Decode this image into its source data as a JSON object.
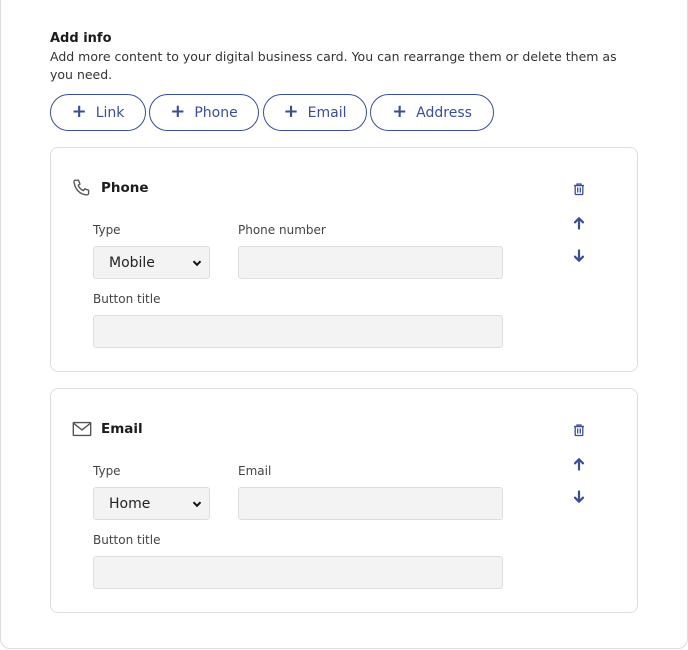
{
  "add_info": {
    "title": "Add info",
    "description": "Add more content to your digital business card. You can rearrange them or delete them as you need.",
    "buttons": [
      {
        "label": "Link",
        "icon": "plus-icon"
      },
      {
        "label": "Phone",
        "icon": "plus-icon"
      },
      {
        "label": "Email",
        "icon": "plus-icon"
      },
      {
        "label": "Address",
        "icon": "plus-icon"
      }
    ]
  },
  "cards": [
    {
      "title": "Phone",
      "icon": "phone-icon",
      "type_label": "Type",
      "type_value": "Mobile",
      "value_label": "Phone number",
      "value": "",
      "button_title_label": "Button title",
      "button_title_value": ""
    },
    {
      "title": "Email",
      "icon": "envelope-icon",
      "type_label": "Type",
      "type_value": "Home",
      "value_label": "Email",
      "value": "",
      "button_title_label": "Button title",
      "button_title_value": ""
    }
  ],
  "colors": {
    "accent": "#3a4d9b",
    "input_bg": "#f3f3f3",
    "border": "#dddddd"
  }
}
